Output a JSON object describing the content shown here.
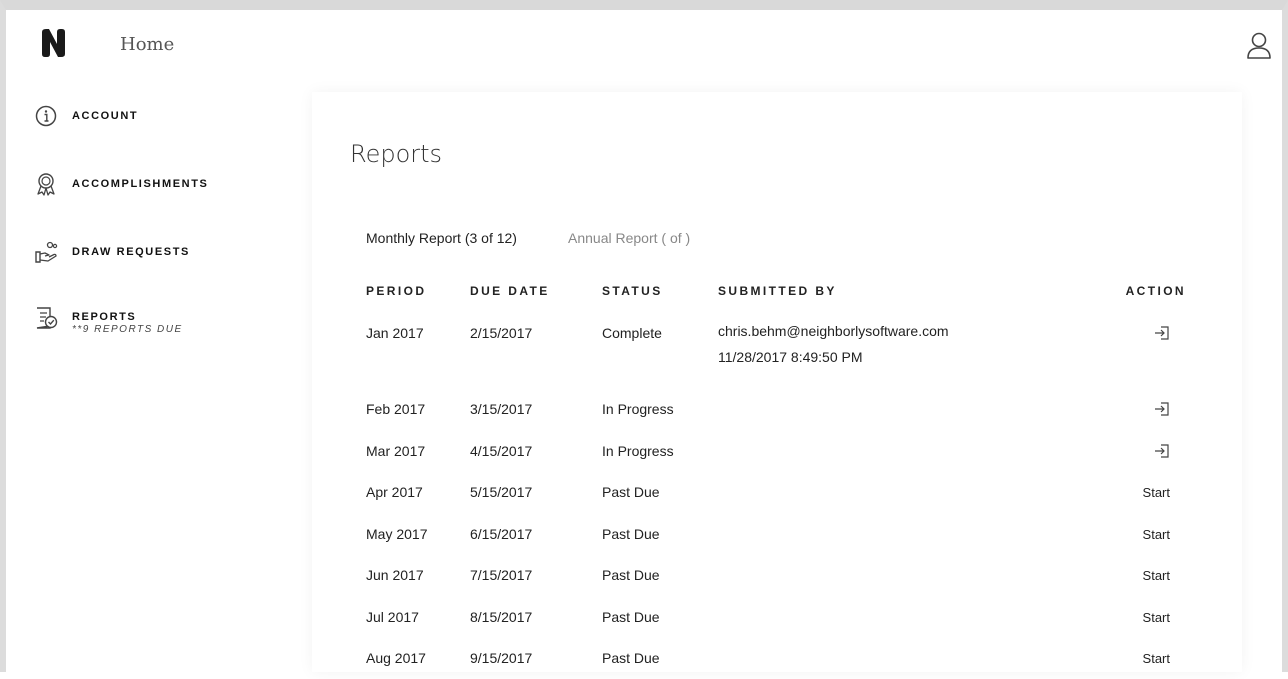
{
  "header": {
    "home_label": "Home"
  },
  "sidebar": {
    "items": [
      {
        "label": "ACCOUNT",
        "icon": "info-circle-icon"
      },
      {
        "label": "ACCOMPLISHMENTS",
        "icon": "award-ribbon-icon"
      },
      {
        "label": "DRAW REQUESTS",
        "icon": "hand-money-icon"
      },
      {
        "label": "REPORTS",
        "sub": "**9 REPORTS DUE",
        "icon": "report-check-icon"
      }
    ]
  },
  "main": {
    "title": "Reports",
    "tabs": [
      {
        "label": "Monthly Report (3 of 12)",
        "active": true
      },
      {
        "label": "Annual Report (  of  )",
        "active": false
      }
    ],
    "table": {
      "headers": [
        "PERIOD",
        "DUE DATE",
        "STATUS",
        "SUBMITTED BY",
        "ACTION"
      ],
      "rows": [
        {
          "period": "Jan 2017",
          "due": "2/15/2017",
          "status": "Complete",
          "submitted_by": "chris.behm@neighborlysoftware.com",
          "submitted_at": "11/28/2017 8:49:50 PM",
          "action": "enter-icon"
        },
        {
          "period": "Feb 2017",
          "due": "3/15/2017",
          "status": "In Progress",
          "submitted_by": "",
          "submitted_at": "",
          "action": "enter-icon"
        },
        {
          "period": "Mar 2017",
          "due": "4/15/2017",
          "status": "In Progress",
          "submitted_by": "",
          "submitted_at": "",
          "action": "enter-icon"
        },
        {
          "period": "Apr 2017",
          "due": "5/15/2017",
          "status": "Past Due",
          "submitted_by": "",
          "submitted_at": "",
          "action": "Start"
        },
        {
          "period": "May 2017",
          "due": "6/15/2017",
          "status": "Past Due",
          "submitted_by": "",
          "submitted_at": "",
          "action": "Start"
        },
        {
          "period": "Jun 2017",
          "due": "7/15/2017",
          "status": "Past Due",
          "submitted_by": "",
          "submitted_at": "",
          "action": "Start"
        },
        {
          "period": "Jul 2017",
          "due": "8/15/2017",
          "status": "Past Due",
          "submitted_by": "",
          "submitted_at": "",
          "action": "Start"
        },
        {
          "period": "Aug 2017",
          "due": "9/15/2017",
          "status": "Past Due",
          "submitted_by": "",
          "submitted_at": "",
          "action": "Start"
        }
      ]
    }
  }
}
